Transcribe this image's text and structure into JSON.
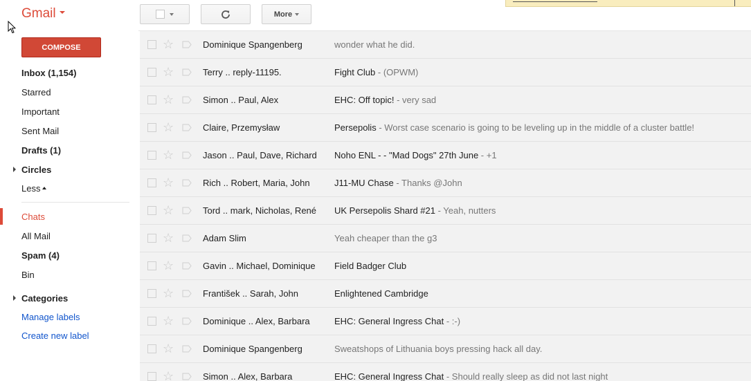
{
  "app": {
    "brand": "Gmail"
  },
  "toolbar": {
    "more_label": "More"
  },
  "compose_label": "COMPOSE",
  "nav": {
    "items": [
      {
        "label": "Inbox (1,154)"
      },
      {
        "label": "Starred"
      },
      {
        "label": "Important"
      },
      {
        "label": "Sent Mail"
      },
      {
        "label": "Drafts (1)"
      },
      {
        "label": "Circles"
      },
      {
        "label": "Less"
      },
      {
        "label": "Chats"
      },
      {
        "label": "All Mail"
      },
      {
        "label": "Spam (4)"
      },
      {
        "label": "Bin"
      },
      {
        "label": "Categories"
      },
      {
        "label": "Manage labels"
      },
      {
        "label": "Create new label"
      }
    ]
  },
  "emails": [
    {
      "sender": "Dominique Spangenberg",
      "subject": "",
      "snippet": "wonder what he did."
    },
    {
      "sender": "Terry .. reply-11195.",
      "subject": "Fight Club ",
      "snippet": " - (OPWM)"
    },
    {
      "sender": "Simon .. Paul, Alex",
      "subject": "EHC: Off topic! ",
      "snippet": " - very sad"
    },
    {
      "sender": "Claire, Przemysław",
      "subject": "Persepolis",
      "snippet": " - Worst case scenario is going to be leveling up in the middle of a cluster battle!"
    },
    {
      "sender": "Jason .. Paul, Dave, Richard",
      "subject": "Noho ENL - - \"Mad Dogs\" 27th June",
      "snippet": " - +1"
    },
    {
      "sender": "Rich .. Robert, Maria, John",
      "subject": "J11-MU Chase",
      "snippet": " - Thanks @John"
    },
    {
      "sender": "Tord .. mark, Nicholas, René",
      "subject": "UK Persepolis Shard #21",
      "snippet": " - Yeah, nutters"
    },
    {
      "sender": "Adam Slim",
      "subject": "",
      "snippet": "Yeah cheaper than the g3"
    },
    {
      "sender": "Gavin .. Michael, Dominique",
      "subject": "Field Badger Club",
      "snippet": ""
    },
    {
      "sender": "František .. Sarah, John",
      "subject": "Enlightened Cambridge",
      "snippet": ""
    },
    {
      "sender": "Dominique .. Alex, Barbara",
      "subject": "EHC: General Ingress Chat ",
      "snippet": " - :-)"
    },
    {
      "sender": "Dominique Spangenberg",
      "subject": "",
      "snippet": "Sweatshops of Lithuania boys pressing hack all day."
    },
    {
      "sender": "Simon .. Alex, Barbara",
      "subject": "EHC: General Ingress Chat ",
      "snippet": " - Should really sleep as did not last night"
    }
  ],
  "colors": {
    "brand_red": "#dd4b39",
    "compose_red": "#d14836",
    "link_blue": "#1155cc",
    "row_bg": "#f2f2f2"
  }
}
